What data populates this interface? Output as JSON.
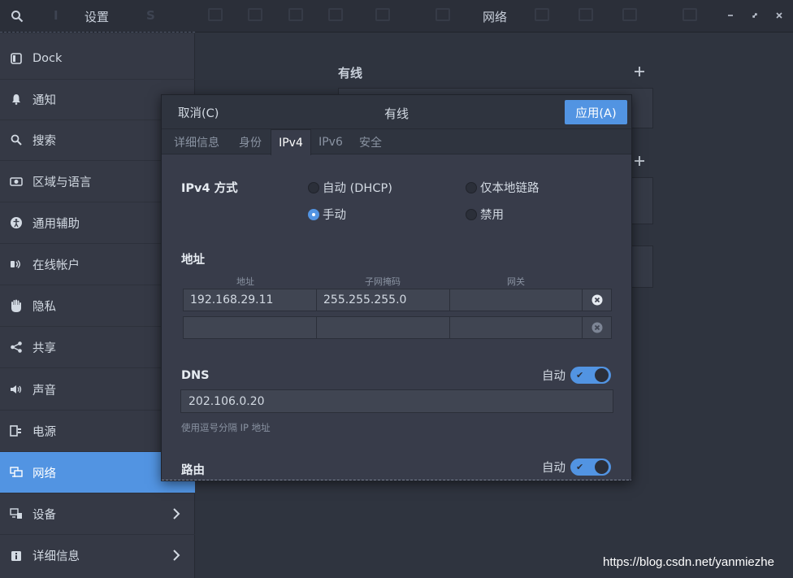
{
  "header": {
    "settings_title": "设置",
    "network_title": "网络"
  },
  "sidebar": {
    "items": [
      {
        "label": "Dock",
        "icon": "dock-icon"
      },
      {
        "label": "通知",
        "icon": "bell-icon"
      },
      {
        "label": "搜索",
        "icon": "search-icon"
      },
      {
        "label": "区域与语言",
        "icon": "camera-icon"
      },
      {
        "label": "通用辅助",
        "icon": "accessibility-icon"
      },
      {
        "label": "在线帐户",
        "icon": "online-accounts-icon"
      },
      {
        "label": "隐私",
        "icon": "hand-icon"
      },
      {
        "label": "共享",
        "icon": "share-icon"
      },
      {
        "label": "声音",
        "icon": "speaker-icon"
      },
      {
        "label": "电源",
        "icon": "power-icon"
      },
      {
        "label": "网络",
        "icon": "network-icon",
        "active": true
      },
      {
        "label": "设备",
        "icon": "devices-icon",
        "chevron": true
      },
      {
        "label": "详细信息",
        "icon": "info-icon",
        "chevron": true
      }
    ]
  },
  "network": {
    "wired_title": "有线"
  },
  "dialog": {
    "cancel_label": "取消(C)",
    "title": "有线",
    "apply_label": "应用(A)",
    "tabs": [
      "详细信息",
      "身份",
      "IPv4",
      "IPv6",
      "安全"
    ],
    "active_tab": "IPv4",
    "ipv4_method_label": "IPv4 方式",
    "methods": {
      "auto_dhcp": "自动 (DHCP)",
      "link_local": "仅本地链路",
      "manual": "手动",
      "disable": "禁用",
      "selected": "manual"
    },
    "address_section": {
      "label": "地址",
      "columns": [
        "地址",
        "子网掩码",
        "网关"
      ],
      "rows": [
        {
          "address": "192.168.29.11",
          "netmask": "255.255.255.0",
          "gateway": ""
        },
        {
          "address": "",
          "netmask": "",
          "gateway": ""
        }
      ]
    },
    "dns": {
      "label": "DNS",
      "auto_label": "自动",
      "auto_enabled": true,
      "value": "202.106.0.20",
      "hint": "使用逗号分隔 IP 地址"
    },
    "routes": {
      "label": "路由",
      "auto_label": "自动",
      "auto_enabled": true
    }
  },
  "watermark": "https://blog.csdn.net/yanmiezhe",
  "colors": {
    "accent": "#5294e2",
    "background": "#2f343f",
    "sidebar": "#353945"
  }
}
